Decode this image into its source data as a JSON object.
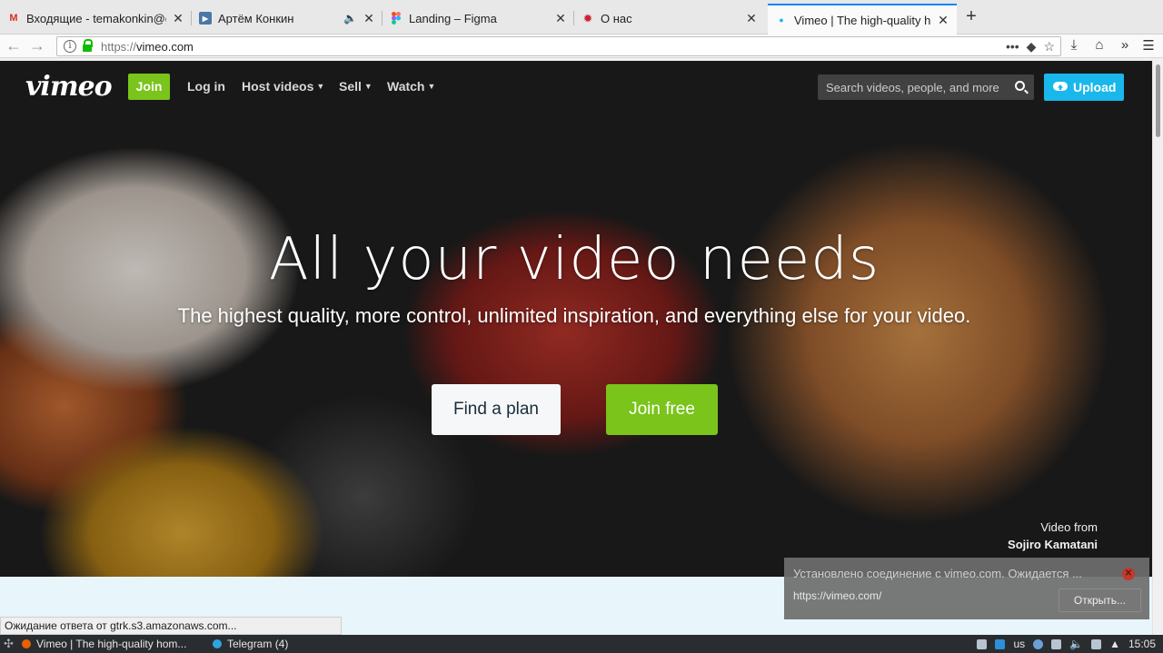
{
  "browser": {
    "tabs": [
      {
        "title": "Входящие - temakonkin@g",
        "icon": "gmail-icon"
      },
      {
        "title": "Артём Конкин",
        "icon": "video-icon"
      },
      {
        "title": "Landing – Figma",
        "icon": "figma-icon"
      },
      {
        "title": "О нас",
        "icon": "bug-icon"
      },
      {
        "title": "Vimeo | The high-quality ho",
        "icon": "dot-icon"
      }
    ],
    "url_scheme": "https://",
    "url_host": "vimeo.com",
    "url_dots": "•••"
  },
  "vimeo": {
    "logo": "vimeo",
    "join_label": "Join",
    "login_label": "Log in",
    "host_label": "Host videos",
    "sell_label": "Sell",
    "watch_label": "Watch",
    "search_placeholder": "Search videos, people, and more",
    "upload_label": "Upload",
    "headline": "All your video needs",
    "subline": "The highest quality, more control, unlimited inspiration, and everything else for your video.",
    "find_plan_label": "Find a plan",
    "join_free_label": "Join free",
    "credit_prefix": "Video from",
    "credit_name": "Sojiro Kamatani"
  },
  "status": {
    "text": "Ожидание ответа от gtrk.s3.amazonaws.com..."
  },
  "notification": {
    "message": "Установлено соединение с vimeo.com. Ожидается ...",
    "url": "https://vimeo.com/",
    "open_label": "Открыть..."
  },
  "taskbar": {
    "tasks": [
      {
        "title": "Vimeo | The high-quality hom..."
      },
      {
        "title": "Telegram (4)"
      }
    ],
    "layout": "us",
    "clock": "15:05"
  }
}
